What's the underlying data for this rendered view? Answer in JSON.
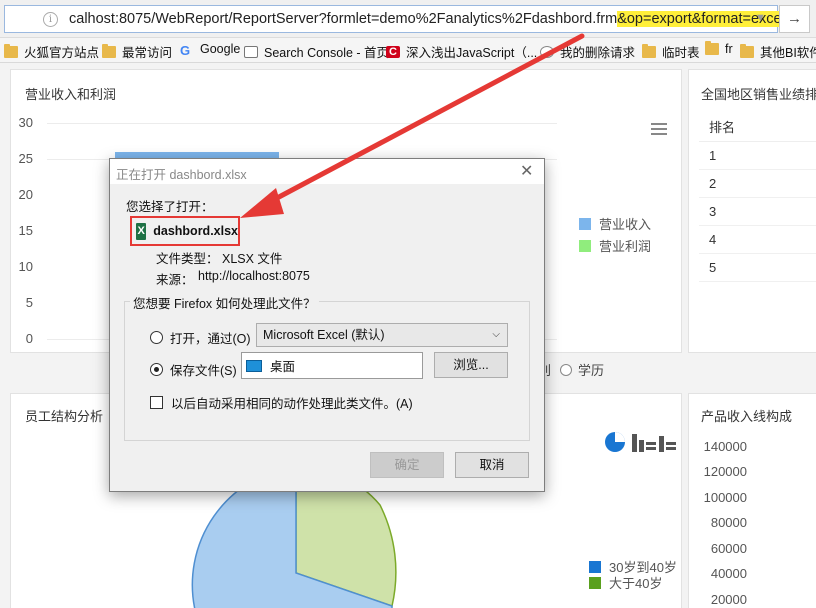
{
  "browser": {
    "url_prefix": "calhost:8075/WebReport/ReportServer?formlet=demo%2Fanalytics%2Fdashbord.frm",
    "url_highlight": "&op=export&format=excel",
    "go_icon": "arrow-right-icon",
    "bookmarks": [
      {
        "label": "火狐官方站点",
        "icon": "folder-icon"
      },
      {
        "label": "最常访问",
        "icon": "folder-icon"
      },
      {
        "label": "Google",
        "icon": "google-icon"
      },
      {
        "label": "Search Console - 首页",
        "icon": "search-console-icon"
      },
      {
        "label": "深入浅出JavaScript（...",
        "icon": "c-icon"
      },
      {
        "label": "我的删除请求",
        "icon": "delete-icon"
      },
      {
        "label": "临时表",
        "icon": "folder-icon"
      },
      {
        "label": "fr",
        "icon": "folder-icon"
      },
      {
        "label": "其他BI软件",
        "icon": "folder-icon"
      }
    ]
  },
  "panels": {
    "revenue": {
      "title": "营业收入和利润",
      "y_ticks": [
        "30",
        "25",
        "20",
        "15",
        "10",
        "5",
        "0"
      ],
      "legend": [
        {
          "label": "营业收入",
          "color": "#7cb5ec"
        },
        {
          "label": "营业利润",
          "color": "#90ed7d"
        }
      ]
    },
    "region": {
      "title": "全国地区销售业绩排",
      "rank_header": "排名",
      "ranks": [
        "1",
        "2",
        "3",
        "4",
        "5"
      ]
    },
    "filter": {
      "items": [
        "别",
        "学历"
      ]
    },
    "staff": {
      "title": "员工结构分析",
      "legend": [
        {
          "label": "30岁到40岁",
          "color": "#1976d2"
        },
        {
          "label": "大于40岁",
          "color": "#5aa01e"
        }
      ]
    },
    "product": {
      "title": "产品收入线构成",
      "y_ticks": [
        "140000",
        "120000",
        "100000",
        "80000",
        "60000",
        "40000",
        "20000"
      ]
    }
  },
  "dialog": {
    "title": "正在打开 dashbord.xlsx",
    "chosen_label": "您选择了打开：",
    "file_name": "dashbord.xlsx",
    "file_type_label": "文件类型：",
    "file_type_value": "XLSX 文件",
    "source_label": "来源：",
    "source_value": "http://localhost:8075",
    "question": "您想要 Firefox 如何处理此文件？",
    "open_with_label": "打开，通过(O)",
    "open_with_value": "Microsoft Excel (默认)",
    "save_label": "保存文件(S)",
    "save_folder": "桌面",
    "browse_label": "浏览...",
    "auto_label": "以后自动采用相同的动作处理此类文件。(A)",
    "ok_label": "确定",
    "cancel_label": "取消",
    "open_with_selected": false,
    "save_selected": true,
    "auto_checked": false
  }
}
